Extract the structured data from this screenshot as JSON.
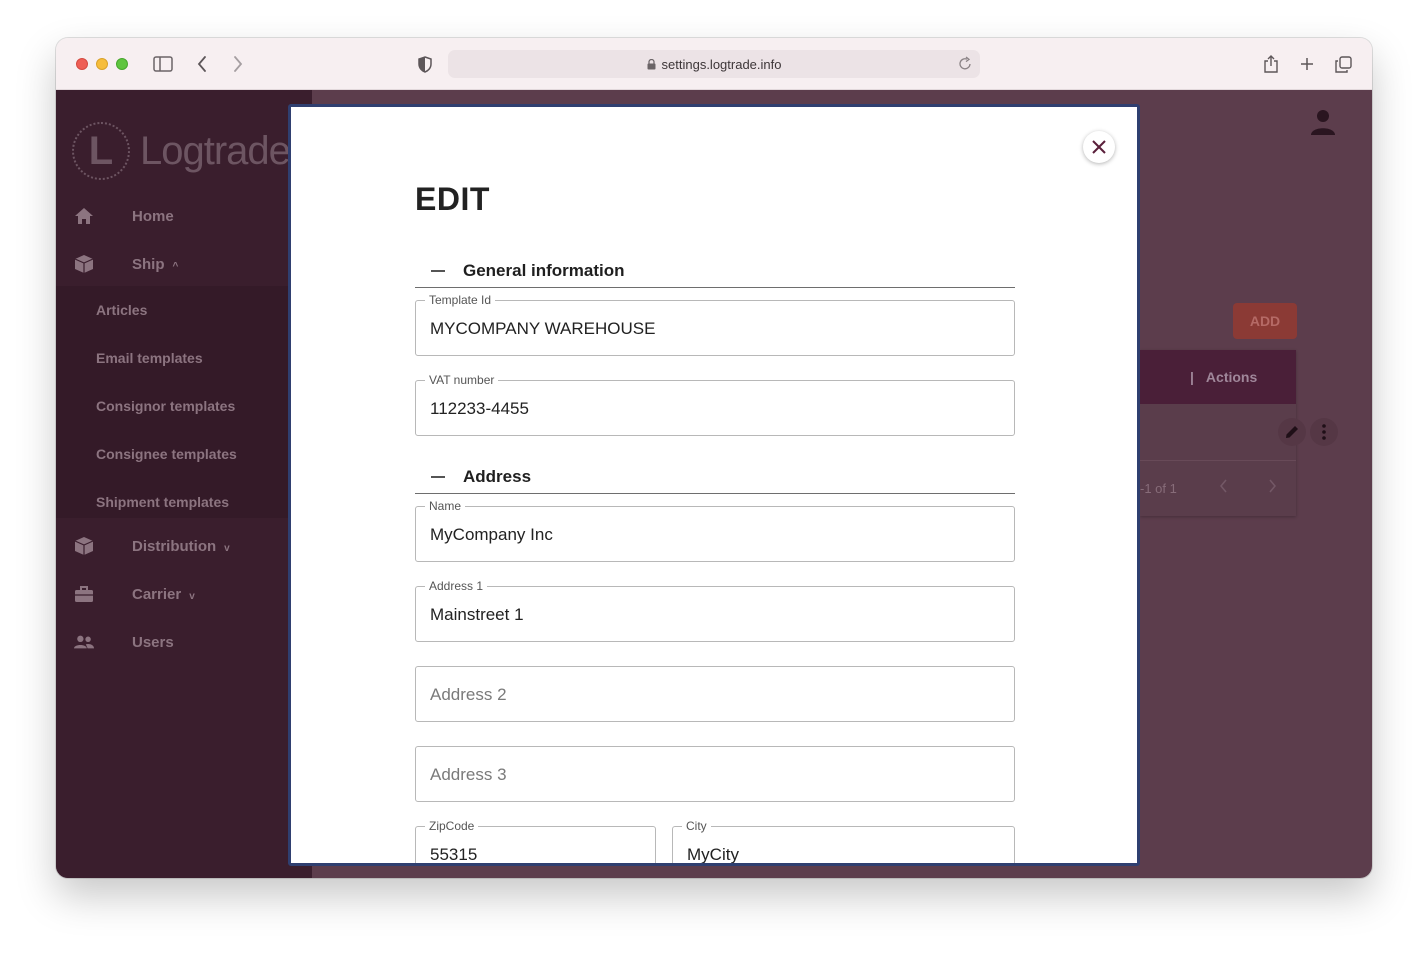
{
  "browser": {
    "url": "settings.logtrade.info"
  },
  "logo": {
    "letter": "L",
    "text": "Logtrade"
  },
  "sidebar": {
    "items": [
      {
        "label": "Home",
        "icon": "home-icon"
      },
      {
        "label": "Ship",
        "icon": "box-icon",
        "chevron": "^"
      },
      {
        "label": "Distribution",
        "icon": "box-icon",
        "chevron": "v"
      },
      {
        "label": "Carrier",
        "icon": "briefcase-icon",
        "chevron": "v"
      },
      {
        "label": "Users",
        "icon": "users-icon"
      }
    ],
    "ship_subitems": [
      "Articles",
      "Email templates",
      "Consignor templates",
      "Consignee templates",
      "Shipment templates"
    ]
  },
  "main": {
    "add_label": "ADD",
    "table": {
      "actions_header": "Actions",
      "pagination": "-1 of 1"
    }
  },
  "modal": {
    "title": "EDIT",
    "sections": {
      "general": "General information",
      "address": "Address"
    },
    "fields": {
      "template_id": {
        "label": "Template Id",
        "value": "MYCOMPANY WAREHOUSE"
      },
      "vat_number": {
        "label": "VAT number",
        "value": "112233-4455"
      },
      "name": {
        "label": "Name",
        "value": "MyCompany Inc"
      },
      "address1": {
        "label": "Address 1",
        "value": "Mainstreet 1"
      },
      "address2": {
        "placeholder": "Address 2"
      },
      "address3": {
        "placeholder": "Address 3"
      },
      "zipcode": {
        "label": "ZipCode",
        "value": "55315"
      },
      "city": {
        "label": "City",
        "value": "MyCity"
      }
    }
  }
}
